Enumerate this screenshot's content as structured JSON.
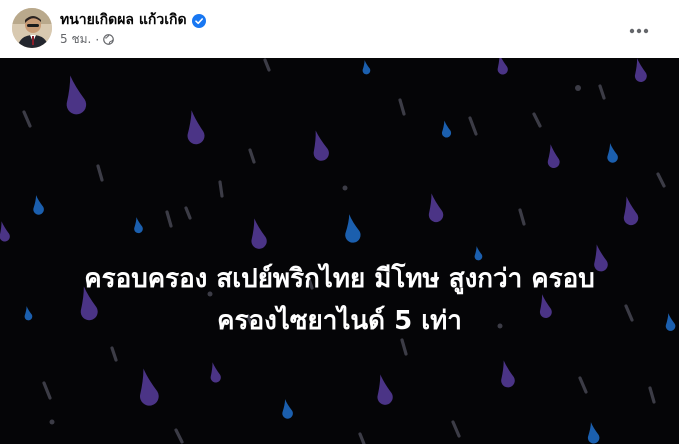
{
  "post": {
    "author": "ทนายเกิดผล แก้วเกิด",
    "time": "5 ชม.",
    "separator": "·",
    "verified_icon": "verified-badge-icon",
    "privacy_icon": "globe-icon",
    "more_icon": "more-horizontal-icon",
    "media": {
      "background_color": "#050507",
      "text_line_1": "ครอบครอง สเปย์พริกไทย มีโทษ สูงกว่า ครอบ",
      "text_line_2": "ครองไซยาไนด์ 5 เท่า",
      "drop_colors": [
        "#5b3f99",
        "#1f6fd1",
        "#4a4a56"
      ]
    }
  }
}
